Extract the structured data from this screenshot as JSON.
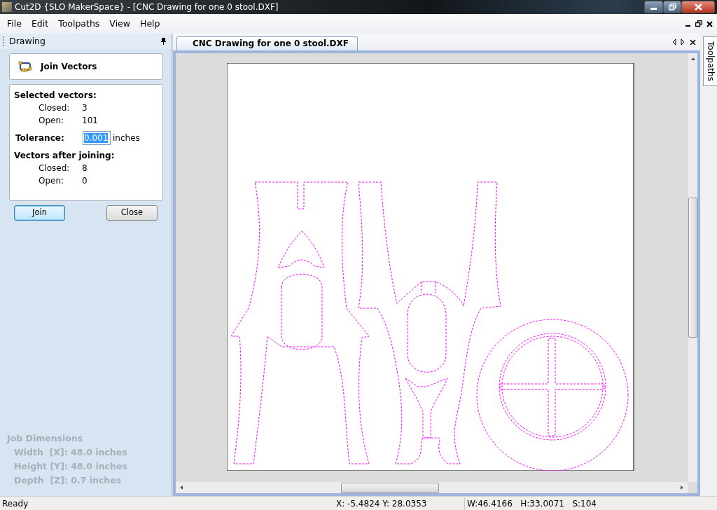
{
  "window": {
    "title": "Cut2D {SLO MakerSpace} - [CNC Drawing for one 0 stool.DXF]"
  },
  "menu": [
    "File",
    "Edit",
    "Toolpaths",
    "View",
    "Help"
  ],
  "panel": {
    "title": "Drawing",
    "tool_title": "Join Vectors",
    "selected_vectors": {
      "heading": "Selected vectors:",
      "rows": [
        {
          "label": "Closed:",
          "value": "3"
        },
        {
          "label": "Open:",
          "value": "101"
        }
      ]
    },
    "tolerance": {
      "label": "Tolerance:",
      "value": "0.001",
      "unit": "inches",
      "text_selected": true
    },
    "after_joining": {
      "heading": "Vectors after joining:",
      "rows": [
        {
          "label": "Closed:",
          "value": "8"
        },
        {
          "label": "Open:",
          "value": "0"
        }
      ]
    },
    "buttons": [
      {
        "label": "Join",
        "default": true
      },
      {
        "label": "Close",
        "default": false
      }
    ],
    "job_dimensions": {
      "heading": "Job Dimensions",
      "rows": [
        "Width  [X]: 48.0 inches",
        "Height [Y]: 48.0 inches",
        "Depth  [Z]: 0.7 inches"
      ]
    }
  },
  "tabs": [
    {
      "label": "CNC Drawing for one 0 stool.DXF",
      "selected": true
    }
  ],
  "side_tab": {
    "label": "Toolpaths"
  },
  "status_bar": {
    "message": "Ready",
    "cursor": "X: -5.4824 Y: 28.0353",
    "selection": "W:46.4166   H:33.0071   S:104"
  }
}
